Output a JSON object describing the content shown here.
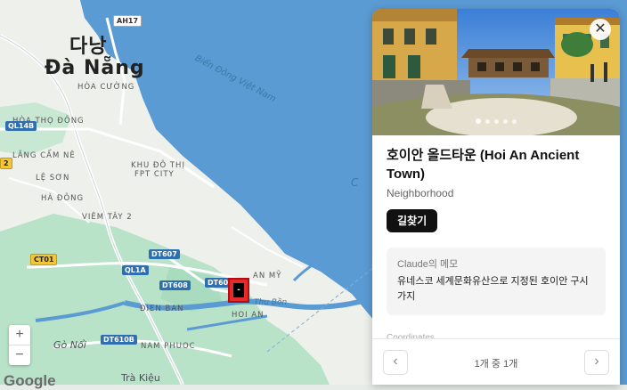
{
  "map": {
    "city_korean": "다낭",
    "city_name": "Đà Nẵng",
    "sea_label": "Biển Đông Việt Nam",
    "sea_label_partial": "C H",
    "districts": [
      "HÒA CƯỜNG",
      "HÒA THỌ ĐÔNG",
      "LĂNG CẨM NÊ",
      "LỆ SƠN",
      "HÀ ĐÔNG",
      "VIÊM TÂY 2",
      "KHU ĐÔ THỊ",
      "FPT CITY",
      "AN MỸ",
      "DIEN BAN",
      "HOI AN",
      "NAM PHUOC",
      "Gò Nổi",
      "Trà Kiệu"
    ],
    "road_shields": [
      "AH17",
      "QL14B",
      "2",
      "CT01",
      "QL1A",
      "DT607",
      "DT608",
      "DT602",
      "DT610B"
    ],
    "river_label": "Thu Bồn",
    "zoom_in": "+",
    "zoom_out": "−",
    "logo": "Google",
    "marker_label": "-"
  },
  "panel": {
    "close": "✕",
    "title": "호이안 올드타운 (Hoi An Ancient Town)",
    "category": "Neighborhood",
    "directions_label": "길찾기",
    "memo_title": "Claude의 메모",
    "memo_text": "유네스코 세계문화유산으로 지정된 호이안 구시가지",
    "next_section": "Coordinates",
    "pager_prev": "‹",
    "pager_next": "›",
    "page_indicator": "1개 중 1개",
    "photo_dots": 5
  },
  "colors": {
    "sea": "#5b9bd3",
    "land": "#eef0ec",
    "marker": "#e52a2a",
    "button": "#111111"
  }
}
